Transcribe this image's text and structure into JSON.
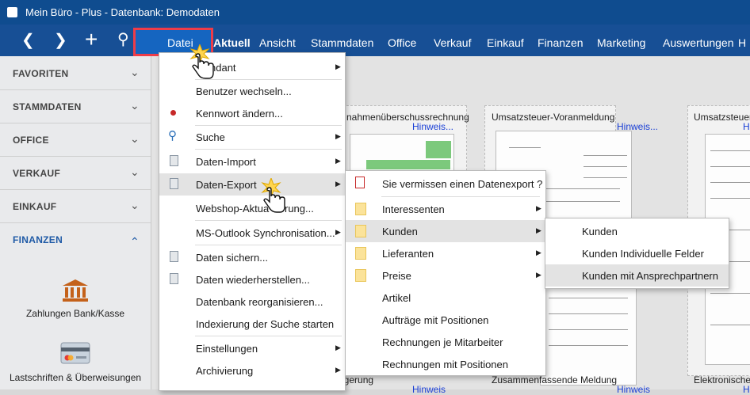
{
  "window": {
    "title": "Mein Büro - Plus - Datenbank: Demodaten"
  },
  "nav": {
    "back": "❮",
    "forward": "❯",
    "add": "+",
    "search": "⚲",
    "menus": [
      "Datei",
      "Aktuell",
      "Ansicht",
      "Stammdaten",
      "Office",
      "Verkauf",
      "Einkauf",
      "Finanzen",
      "Marketing",
      "Auswertungen",
      "H"
    ]
  },
  "sidebar": {
    "sections": [
      {
        "label": "FAVORITEN",
        "chevron": "⌄"
      },
      {
        "label": "STAMMDATEN",
        "chevron": "⌄"
      },
      {
        "label": "OFFICE",
        "chevron": "⌄"
      },
      {
        "label": "VERKAUF",
        "chevron": "⌄"
      },
      {
        "label": "EINKAUF",
        "chevron": "⌄"
      },
      {
        "label": "FINANZEN",
        "chevron": "⌃"
      }
    ],
    "tiles": [
      {
        "label": "Zahlungen Bank/Kasse",
        "icon": "bank-icon"
      },
      {
        "label": "Lastschriften & Überweisungen",
        "icon": "card-icon"
      }
    ]
  },
  "content": {
    "cards": [
      {
        "title": "Einnahmenüberschussrechnung",
        "title_visible": "nahmenüberschussrechnung",
        "hint": "Hinweis..."
      },
      {
        "title": "Umsatzsteuer-Voranmeldung",
        "hint": "Hinweis..."
      },
      {
        "title": "Umsatzsteuererkl",
        "hint": "Hinweis..."
      },
      {
        "title": "Zusammenfassende Meldung",
        "hint": "Hinweis"
      },
      {
        "title": "Elektronischer",
        "hint": "Hinweis"
      }
    ],
    "bottom_left_partial": "ngerung",
    "bottom_left_hint": "Hinweis"
  },
  "datei_menu": {
    "items": [
      {
        "label": "Mandant",
        "visible": "ndant",
        "submenu": true
      },
      {
        "label": "Benutzer wechseln..."
      },
      {
        "label": "Kennwort ändern..."
      },
      {
        "label": "Suche",
        "submenu": true
      },
      {
        "label": "Daten-Import",
        "submenu": true
      },
      {
        "label": "Daten-Export",
        "submenu": true
      },
      {
        "label": "Webshop-Aktualisierung...",
        "visible": "Webshop-Aktua",
        "visible_tail": "rung..."
      },
      {
        "label": "MS-Outlook Synchronisation...",
        "submenu": true
      },
      {
        "label": "Daten sichern..."
      },
      {
        "label": "Daten wiederherstellen..."
      },
      {
        "label": "Datenbank reorganisieren..."
      },
      {
        "label": "Indexierung der Suche starten"
      },
      {
        "label": "Einstellungen",
        "submenu": true
      },
      {
        "label": "Archivierung",
        "submenu": true
      }
    ]
  },
  "export_menu": {
    "items": [
      {
        "label": "Sie vermissen einen Datenexport ?"
      },
      {
        "label": "Interessenten",
        "submenu": true
      },
      {
        "label": "Kunden",
        "submenu": true
      },
      {
        "label": "Lieferanten",
        "submenu": true
      },
      {
        "label": "Preise",
        "submenu": true
      },
      {
        "label": "Artikel"
      },
      {
        "label": "Aufträge mit Positionen"
      },
      {
        "label": "Rechnungen je Mitarbeiter"
      },
      {
        "label": "Rechnungen mit Positionen"
      }
    ]
  },
  "kunden_menu": {
    "items": [
      {
        "label": "Kunden"
      },
      {
        "label": "Kunden Individuelle Felder"
      },
      {
        "label": "Kunden mit Ansprechpartnern"
      }
    ]
  },
  "arrow": "▶",
  "colors": {
    "titlebar": "#0f4c8f",
    "navbar": "#174f95",
    "highlight_box": "#ee3c48",
    "accent": "#1565c0"
  }
}
